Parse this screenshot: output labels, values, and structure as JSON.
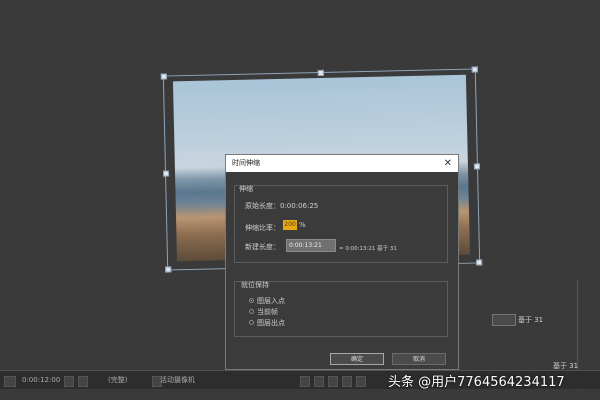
{
  "dialog": {
    "title": "时间伸缩",
    "stretch_group": {
      "title": "伸缩",
      "original_duration_label": "原始长度：0:00:06:25",
      "stretch_factor_label": "伸缩比率：",
      "stretch_factor_value": "200",
      "percent_sign": "%",
      "new_duration_label": "新建长度：",
      "new_duration_value": "0:00:13:21",
      "equals_text": "= 0:00:13:21 基于 31"
    },
    "hold_group": {
      "title": "就位保持",
      "options": [
        "图层入点",
        "当前帧",
        "图层出点"
      ],
      "selected": 0
    },
    "ok_label": "确定",
    "cancel_label": "取消"
  },
  "right_panel": {
    "base_text_1": "基于 31",
    "base_text_2": "基于 31"
  },
  "toolbar": {
    "timecode": "0:00:12:00",
    "quality": "(完整)",
    "camera": "活动摄像机"
  },
  "watermark": "头条 @用户7764564234117"
}
